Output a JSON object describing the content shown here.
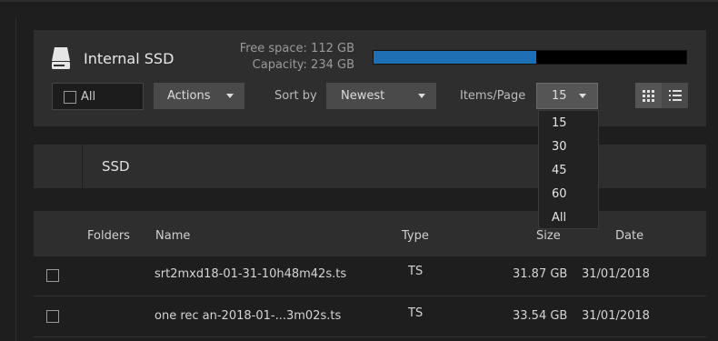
{
  "storage": {
    "title": "Internal SSD",
    "free_space": "Free space: 112 GB",
    "capacity": "Capacity: 234 GB",
    "used_fraction": 0.52,
    "bar_color": "#1f6fb5"
  },
  "toolbar": {
    "all_label": "All",
    "actions_label": "Actions",
    "sort_label": "Sort by",
    "sort_value": "Newest",
    "items_page_label": "Items/Page",
    "items_page_value": "15",
    "view_grid_icon": "grid-view-icon",
    "view_list_icon": "list-view-icon"
  },
  "items_page_options": [
    "15",
    "30",
    "45",
    "60",
    "All"
  ],
  "folder": {
    "name": "SSD"
  },
  "table": {
    "headers": {
      "folders": "Folders",
      "name": "Name",
      "type": "Type",
      "size": "Size",
      "date": "Date"
    },
    "rows": [
      {
        "name": "srt2mxd18-01-31-10h48m42s.ts",
        "type": "TS",
        "size": "31.87 GB",
        "date": "31/01/2018"
      },
      {
        "name": "one rec an-2018-01-...3m02s.ts",
        "type": "TS",
        "size": "33.54 GB",
        "date": "31/01/2018"
      }
    ]
  }
}
